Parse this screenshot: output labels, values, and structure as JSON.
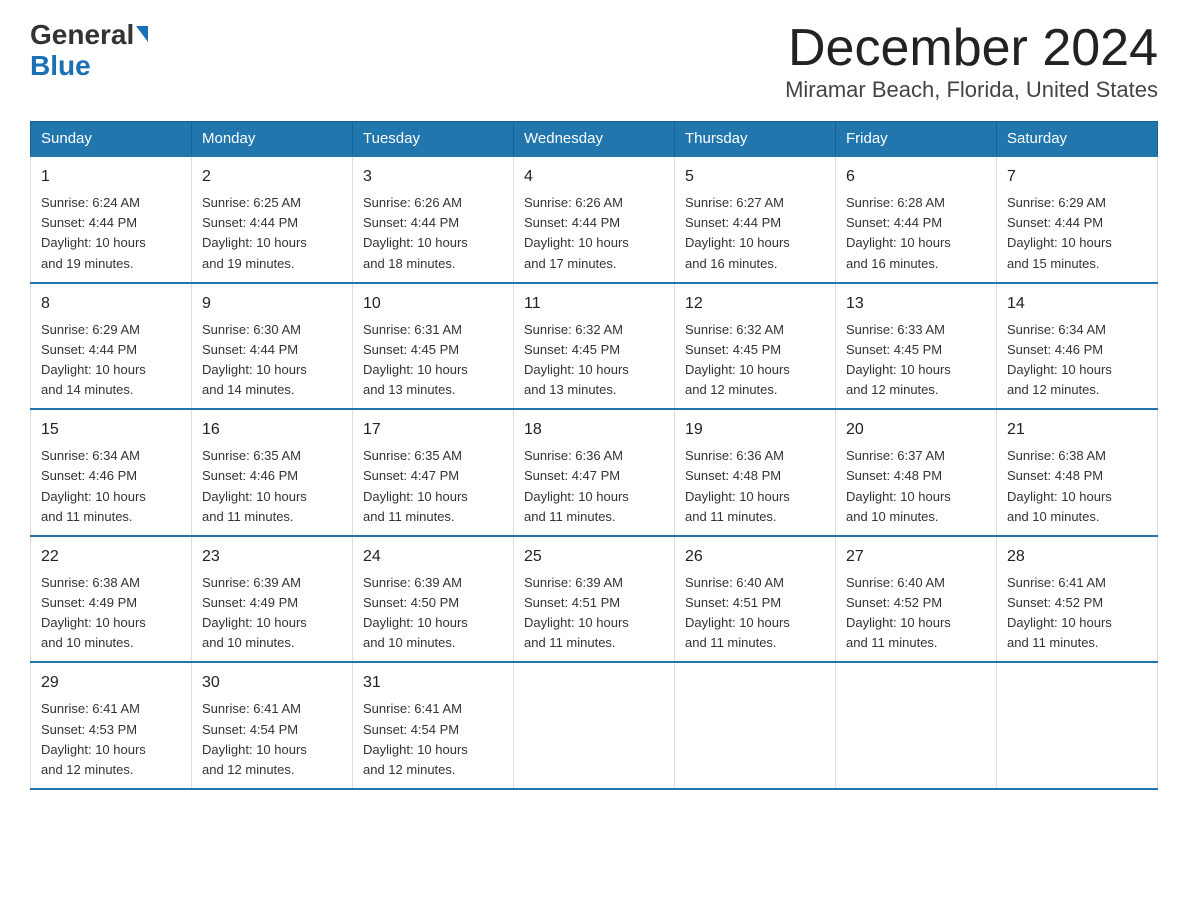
{
  "header": {
    "logo_general": "General",
    "logo_blue": "Blue",
    "title": "December 2024",
    "subtitle": "Miramar Beach, Florida, United States"
  },
  "weekdays": [
    "Sunday",
    "Monday",
    "Tuesday",
    "Wednesday",
    "Thursday",
    "Friday",
    "Saturday"
  ],
  "weeks": [
    [
      {
        "day": "1",
        "sunrise": "6:24 AM",
        "sunset": "4:44 PM",
        "daylight": "10 hours and 19 minutes."
      },
      {
        "day": "2",
        "sunrise": "6:25 AM",
        "sunset": "4:44 PM",
        "daylight": "10 hours and 19 minutes."
      },
      {
        "day": "3",
        "sunrise": "6:26 AM",
        "sunset": "4:44 PM",
        "daylight": "10 hours and 18 minutes."
      },
      {
        "day": "4",
        "sunrise": "6:26 AM",
        "sunset": "4:44 PM",
        "daylight": "10 hours and 17 minutes."
      },
      {
        "day": "5",
        "sunrise": "6:27 AM",
        "sunset": "4:44 PM",
        "daylight": "10 hours and 16 minutes."
      },
      {
        "day": "6",
        "sunrise": "6:28 AM",
        "sunset": "4:44 PM",
        "daylight": "10 hours and 16 minutes."
      },
      {
        "day": "7",
        "sunrise": "6:29 AM",
        "sunset": "4:44 PM",
        "daylight": "10 hours and 15 minutes."
      }
    ],
    [
      {
        "day": "8",
        "sunrise": "6:29 AM",
        "sunset": "4:44 PM",
        "daylight": "10 hours and 14 minutes."
      },
      {
        "day": "9",
        "sunrise": "6:30 AM",
        "sunset": "4:44 PM",
        "daylight": "10 hours and 14 minutes."
      },
      {
        "day": "10",
        "sunrise": "6:31 AM",
        "sunset": "4:45 PM",
        "daylight": "10 hours and 13 minutes."
      },
      {
        "day": "11",
        "sunrise": "6:32 AM",
        "sunset": "4:45 PM",
        "daylight": "10 hours and 13 minutes."
      },
      {
        "day": "12",
        "sunrise": "6:32 AM",
        "sunset": "4:45 PM",
        "daylight": "10 hours and 12 minutes."
      },
      {
        "day": "13",
        "sunrise": "6:33 AM",
        "sunset": "4:45 PM",
        "daylight": "10 hours and 12 minutes."
      },
      {
        "day": "14",
        "sunrise": "6:34 AM",
        "sunset": "4:46 PM",
        "daylight": "10 hours and 12 minutes."
      }
    ],
    [
      {
        "day": "15",
        "sunrise": "6:34 AM",
        "sunset": "4:46 PM",
        "daylight": "10 hours and 11 minutes."
      },
      {
        "day": "16",
        "sunrise": "6:35 AM",
        "sunset": "4:46 PM",
        "daylight": "10 hours and 11 minutes."
      },
      {
        "day": "17",
        "sunrise": "6:35 AM",
        "sunset": "4:47 PM",
        "daylight": "10 hours and 11 minutes."
      },
      {
        "day": "18",
        "sunrise": "6:36 AM",
        "sunset": "4:47 PM",
        "daylight": "10 hours and 11 minutes."
      },
      {
        "day": "19",
        "sunrise": "6:36 AM",
        "sunset": "4:48 PM",
        "daylight": "10 hours and 11 minutes."
      },
      {
        "day": "20",
        "sunrise": "6:37 AM",
        "sunset": "4:48 PM",
        "daylight": "10 hours and 10 minutes."
      },
      {
        "day": "21",
        "sunrise": "6:38 AM",
        "sunset": "4:48 PM",
        "daylight": "10 hours and 10 minutes."
      }
    ],
    [
      {
        "day": "22",
        "sunrise": "6:38 AM",
        "sunset": "4:49 PM",
        "daylight": "10 hours and 10 minutes."
      },
      {
        "day": "23",
        "sunrise": "6:39 AM",
        "sunset": "4:49 PM",
        "daylight": "10 hours and 10 minutes."
      },
      {
        "day": "24",
        "sunrise": "6:39 AM",
        "sunset": "4:50 PM",
        "daylight": "10 hours and 10 minutes."
      },
      {
        "day": "25",
        "sunrise": "6:39 AM",
        "sunset": "4:51 PM",
        "daylight": "10 hours and 11 minutes."
      },
      {
        "day": "26",
        "sunrise": "6:40 AM",
        "sunset": "4:51 PM",
        "daylight": "10 hours and 11 minutes."
      },
      {
        "day": "27",
        "sunrise": "6:40 AM",
        "sunset": "4:52 PM",
        "daylight": "10 hours and 11 minutes."
      },
      {
        "day": "28",
        "sunrise": "6:41 AM",
        "sunset": "4:52 PM",
        "daylight": "10 hours and 11 minutes."
      }
    ],
    [
      {
        "day": "29",
        "sunrise": "6:41 AM",
        "sunset": "4:53 PM",
        "daylight": "10 hours and 12 minutes."
      },
      {
        "day": "30",
        "sunrise": "6:41 AM",
        "sunset": "4:54 PM",
        "daylight": "10 hours and 12 minutes."
      },
      {
        "day": "31",
        "sunrise": "6:41 AM",
        "sunset": "4:54 PM",
        "daylight": "10 hours and 12 minutes."
      },
      null,
      null,
      null,
      null
    ]
  ],
  "labels": {
    "sunrise": "Sunrise:",
    "sunset": "Sunset:",
    "daylight": "Daylight:"
  }
}
